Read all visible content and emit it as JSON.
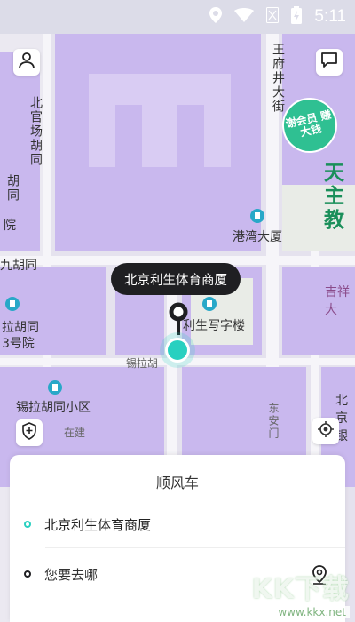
{
  "status_bar": {
    "time": "5:11"
  },
  "map": {
    "labels": {
      "north_guanchang": "北官场胡同",
      "hutong_left": "胡同",
      "hutong_left_2": "院",
      "jiu_hutong": "九胡同",
      "wangfujing": "王府井大街",
      "gangwan": "港湾大厦",
      "tianzhu": "天主教",
      "jixiang": "吉祥大",
      "lihutong": "拉胡同",
      "sanhaoyuan": "3号院",
      "lisheng_office": "利生写字楼",
      "xila_short": "锡拉胡",
      "xila_xiaoqu": "锡拉胡同小区",
      "donganmen": "东安门",
      "beijing_bank": "北京银",
      "beijing_short": "北京",
      "tianjian": "在建"
    },
    "ad_badge_text": "谢会员 赚大钱"
  },
  "callout": {
    "text": "北京利生体育商厦"
  },
  "panel": {
    "title": "顺风车",
    "origin": "北京利生体育商厦",
    "destination_placeholder": "您要去哪"
  },
  "watermark": {
    "main": "KK下载",
    "url": "www.kkx.net"
  },
  "colors": {
    "accent": "#28d0c0",
    "map_block": "#c9b8ee",
    "dark_pin": "#1f1f22"
  }
}
